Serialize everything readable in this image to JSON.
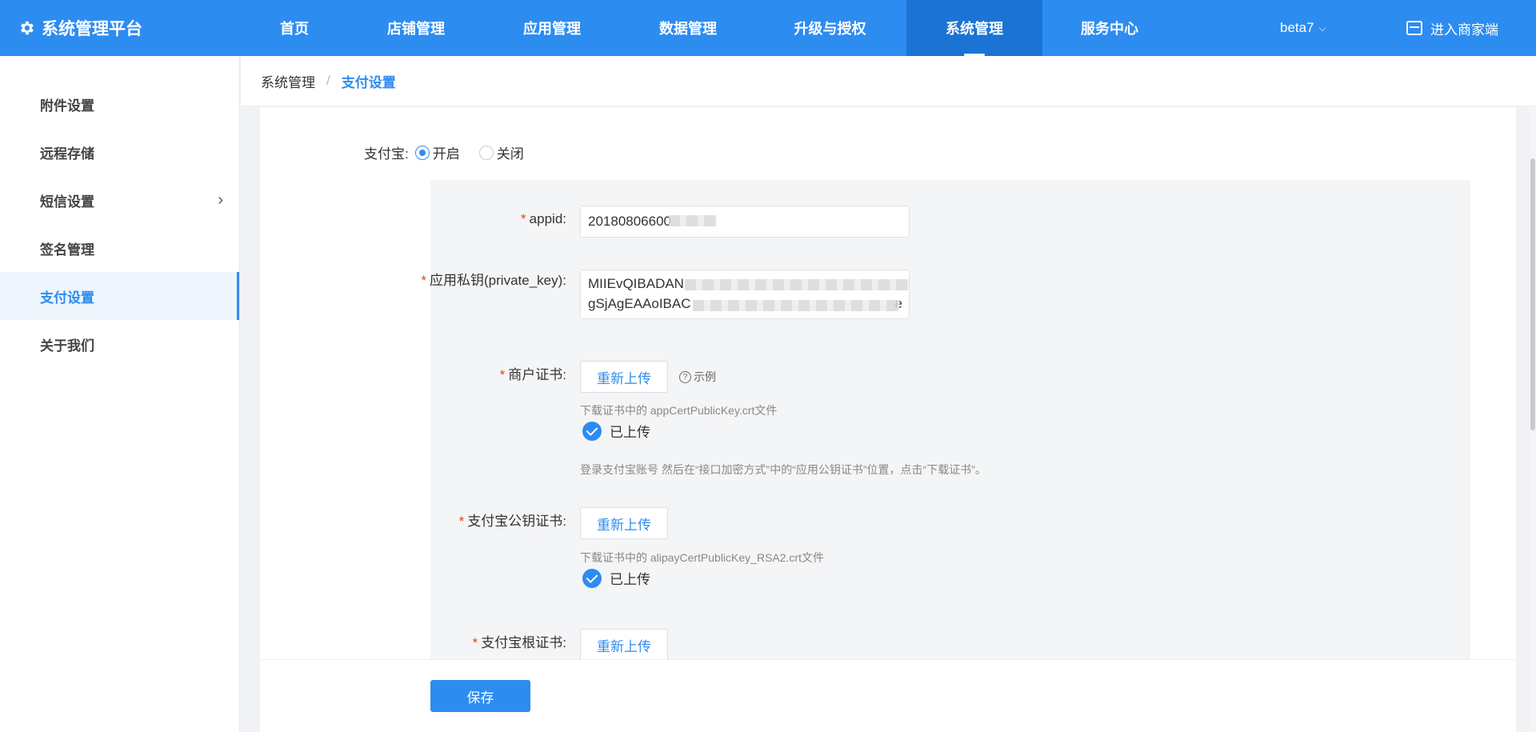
{
  "app": {
    "title": "系统管理平台"
  },
  "nav": {
    "items": [
      "首页",
      "店铺管理",
      "应用管理",
      "数据管理",
      "升级与授权",
      "系统管理",
      "服务中心"
    ],
    "active": "系统管理",
    "user": "beta7",
    "merchant_link": "进入商家端"
  },
  "sidebar": {
    "items": [
      {
        "label": "附件设置"
      },
      {
        "label": "远程存储"
      },
      {
        "label": "短信设置",
        "has_submenu": true
      },
      {
        "label": "签名管理"
      },
      {
        "label": "支付设置",
        "active": true
      },
      {
        "label": "关于我们"
      }
    ]
  },
  "breadcrumb": {
    "parent": "系统管理",
    "separator": "/",
    "current": "支付设置"
  },
  "form": {
    "alipay_label": "支付宝:",
    "radio_on": "开启",
    "radio_off": "关闭",
    "radio_selected": "开启",
    "required_mark": "*",
    "appid_label": "appid:",
    "appid_value": "20180806600",
    "private_key_label": "应用私钥(private_key):",
    "private_key_value": "MIIEvQIBADAN\ngSjAgEAAoIBAC",
    "private_key_tail": "e",
    "merchant_cert_label": "商户证书:",
    "reupload": "重新上传",
    "example": "示例",
    "merchant_cert_hint": "下载证书中的 appCertPublicKey.crt文件",
    "uploaded": "已上传",
    "merchant_cert_help": "登录支付宝账号 然后在“接口加密方式”中的“应用公钥证书”位置，点击“下载证书”。",
    "alipay_pub_cert_label": "支付宝公钥证书:",
    "alipay_pub_cert_hint": "下载证书中的 alipayCertPublicKey_RSA2.crt文件",
    "alipay_root_cert_label": "支付宝根证书:"
  },
  "actions": {
    "save": "保存"
  },
  "colors": {
    "primary": "#2d8cf0",
    "required": "#ed4014"
  }
}
